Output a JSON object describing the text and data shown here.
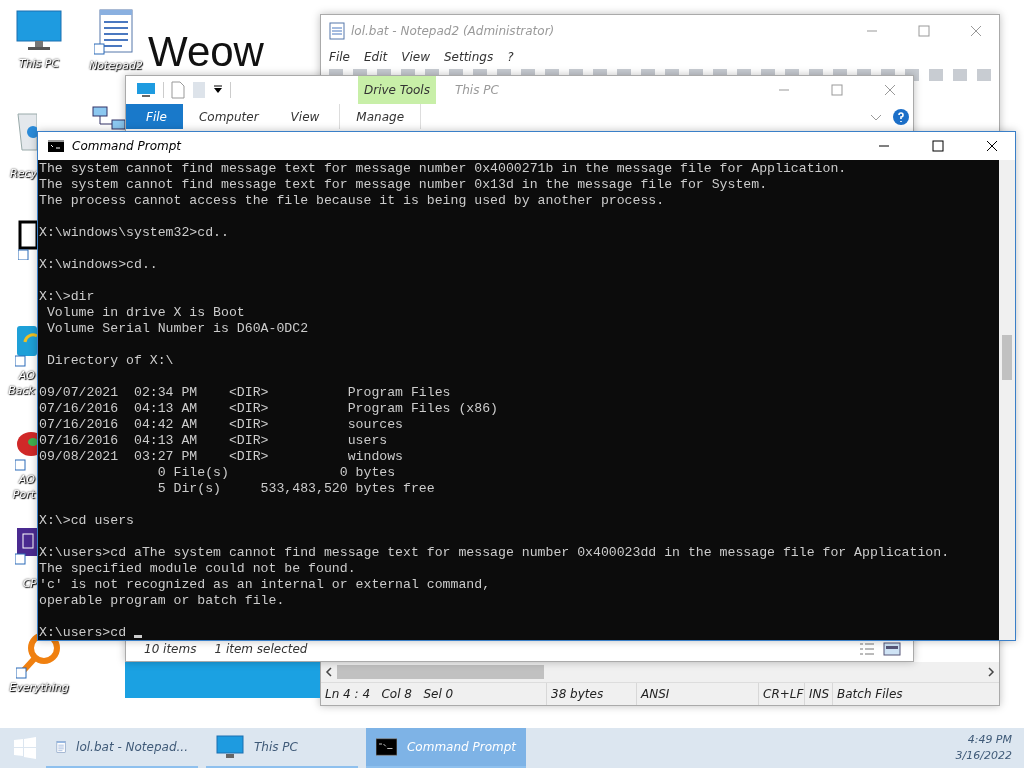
{
  "desktop": {
    "banner_text": "Weow",
    "icons": [
      {
        "kind": "monitor",
        "label_lines": [
          "This PC"
        ]
      },
      {
        "kind": "notepad",
        "label_lines": [
          "Notepad2"
        ]
      },
      {
        "kind": "network"
      },
      {
        "kind": "recycle",
        "label_lines": [
          "Recy"
        ]
      },
      {
        "kind": "help"
      },
      {
        "kind": "backup",
        "label_lines": [
          "AO",
          "Back"
        ]
      },
      {
        "kind": "partition",
        "label_lines": [
          "AO",
          "Port"
        ]
      },
      {
        "kind": "cpu",
        "label_lines": [
          "CP"
        ]
      },
      {
        "kind": "search",
        "label_lines": [
          "Everything"
        ]
      }
    ]
  },
  "notepad": {
    "title": "lol.bat - Notepad2 (Administrator)",
    "menu": [
      "File",
      "Edit",
      "View",
      "Settings",
      "?"
    ],
    "status": [
      "Ln 4 : 4   Col 8   Sel 0",
      "38 bytes",
      "ANSI",
      "CR+LF",
      "INS",
      "Batch Files"
    ]
  },
  "explorer": {
    "title": "This PC",
    "context_group": "Drive Tools",
    "tabs": [
      {
        "label": "File",
        "selected": true
      },
      {
        "label": "Computer",
        "selected": false
      },
      {
        "label": "View",
        "selected": false
      },
      {
        "label": "Manage",
        "selected": false
      }
    ],
    "status": [
      "10 items",
      "1 item selected"
    ]
  },
  "console": {
    "title": "Command Prompt",
    "blocks": [
      [
        "The system cannot find message text for message number 0x4000271b in the message file for Application.",
        "The system cannot find message text for message number 0x13d in the message file for System.",
        "The process cannot access the file because it is being used by another process."
      ],
      [
        "X:\\windows\\system32>cd.."
      ],
      [
        "X:\\windows>cd.."
      ],
      [
        "X:\\>dir",
        " Volume in drive X is Boot",
        " Volume Serial Number is D60A-0DC2"
      ],
      [
        " Directory of X:\\"
      ],
      [
        "09/07/2021  02:34 PM    <DIR>          Program Files",
        "07/16/2016  04:13 AM    <DIR>          Program Files (x86)",
        "07/16/2016  04:42 AM    <DIR>          sources",
        "07/16/2016  04:13 AM    <DIR>          users",
        "09/08/2021  03:27 PM    <DIR>          windows",
        "               0 File(s)              0 bytes",
        "               5 Dir(s)     533,483,520 bytes free"
      ],
      [
        "X:\\>cd users"
      ],
      [
        "X:\\users>cd aThe system cannot find message text for message number 0x400023dd in the message file for Application.",
        "The specified module could not be found.",
        "'c' is not recognized as an internal or external command,",
        "operable program or batch file."
      ],
      [
        "X:\\users>cd "
      ]
    ]
  },
  "taskbar": {
    "items": [
      {
        "label": "lol.bat - Notepad...",
        "selected": false
      },
      {
        "label": "This PC",
        "selected": false
      },
      {
        "label": "Command Prompt",
        "selected": true
      }
    ],
    "time": "4:49 PM",
    "date": "3/16/2022"
  }
}
